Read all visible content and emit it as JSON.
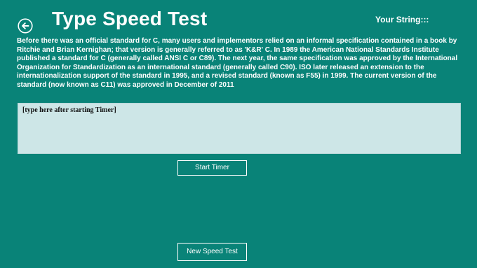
{
  "header": {
    "title": "Type Speed Test",
    "back_icon": "back-arrow-icon",
    "your_string_label": "Your String:::"
  },
  "passage": "Before there was an official standard for C, many users and implementors relied on an informal specification contained in a book by Ritchie and Brian Kernighan; that version is generally referred to as 'K&R' C. In 1989 the American National Standards Institute published a standard for C (generally called ANSI C or C89). The next year, the same specification was approved by the International Organization for Standardization as an international standard (generally called C90). ISO later released an extension to the internationalization support of the standard in 1995, and a revised standard (known as F55) in 1999. The current version of the standard (now known as C11) was approved in December of 2011",
  "input": {
    "value": "",
    "placeholder": "[type here after starting Timer]"
  },
  "buttons": {
    "start_timer": "Start Timer",
    "new_speed_test": "New Speed Test"
  },
  "colors": {
    "background": "#098378",
    "input_background": "#cde6e7",
    "text": "#ffffff"
  }
}
